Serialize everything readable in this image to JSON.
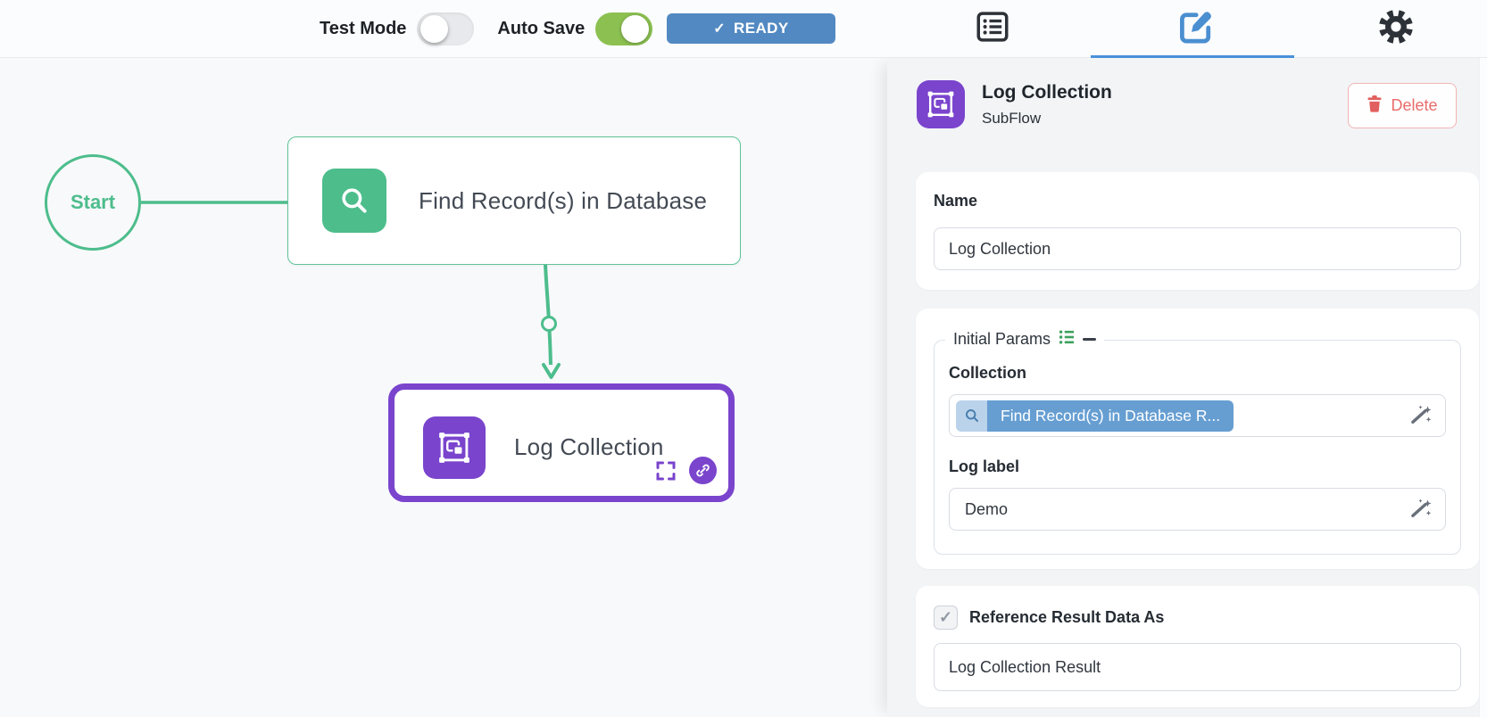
{
  "colors": {
    "flow_green": "#4dbd8c",
    "toggle_green": "#8cc152",
    "node_purple": "#7a44cd",
    "ready_blue": "#5289c2",
    "active_tab_blue": "#4a90d9",
    "chip_blue": "#669ed2",
    "chip_light_blue": "#bad3eb",
    "delete_red": "#ea6b6b",
    "canvas_bg": "#f8f9fb",
    "panel_bg": "#f2f4f6"
  },
  "topbar": {
    "test_mode": {
      "label": "Test Mode",
      "state": "off"
    },
    "auto_save": {
      "label": "Auto Save",
      "state": "on"
    },
    "status": {
      "check": "✓",
      "label": "READY"
    },
    "tabs": [
      {
        "name": "node-list",
        "active": false
      },
      {
        "name": "node-editor",
        "active": true
      },
      {
        "name": "settings",
        "active": false
      }
    ]
  },
  "canvas": {
    "start_label": "Start",
    "nodes": [
      {
        "title": "Find Record(s) in Database",
        "type": "find-records"
      },
      {
        "title": "Log Collection",
        "type": "subflow"
      }
    ]
  },
  "panel": {
    "header": {
      "title": "Log Collection",
      "subtitle": "SubFlow",
      "delete_label": "Delete"
    },
    "name_field": {
      "label": "Name",
      "value": "Log Collection"
    },
    "initial_params": {
      "legend": "Initial Params",
      "collection_field": {
        "label": "Collection",
        "chip_text": "Find Record(s) in Database R..."
      },
      "log_label_field": {
        "label": "Log label",
        "value": "Demo"
      }
    },
    "reference": {
      "checked": true,
      "check": "✓",
      "label": "Reference Result Data As",
      "value": "Log Collection Result"
    }
  }
}
